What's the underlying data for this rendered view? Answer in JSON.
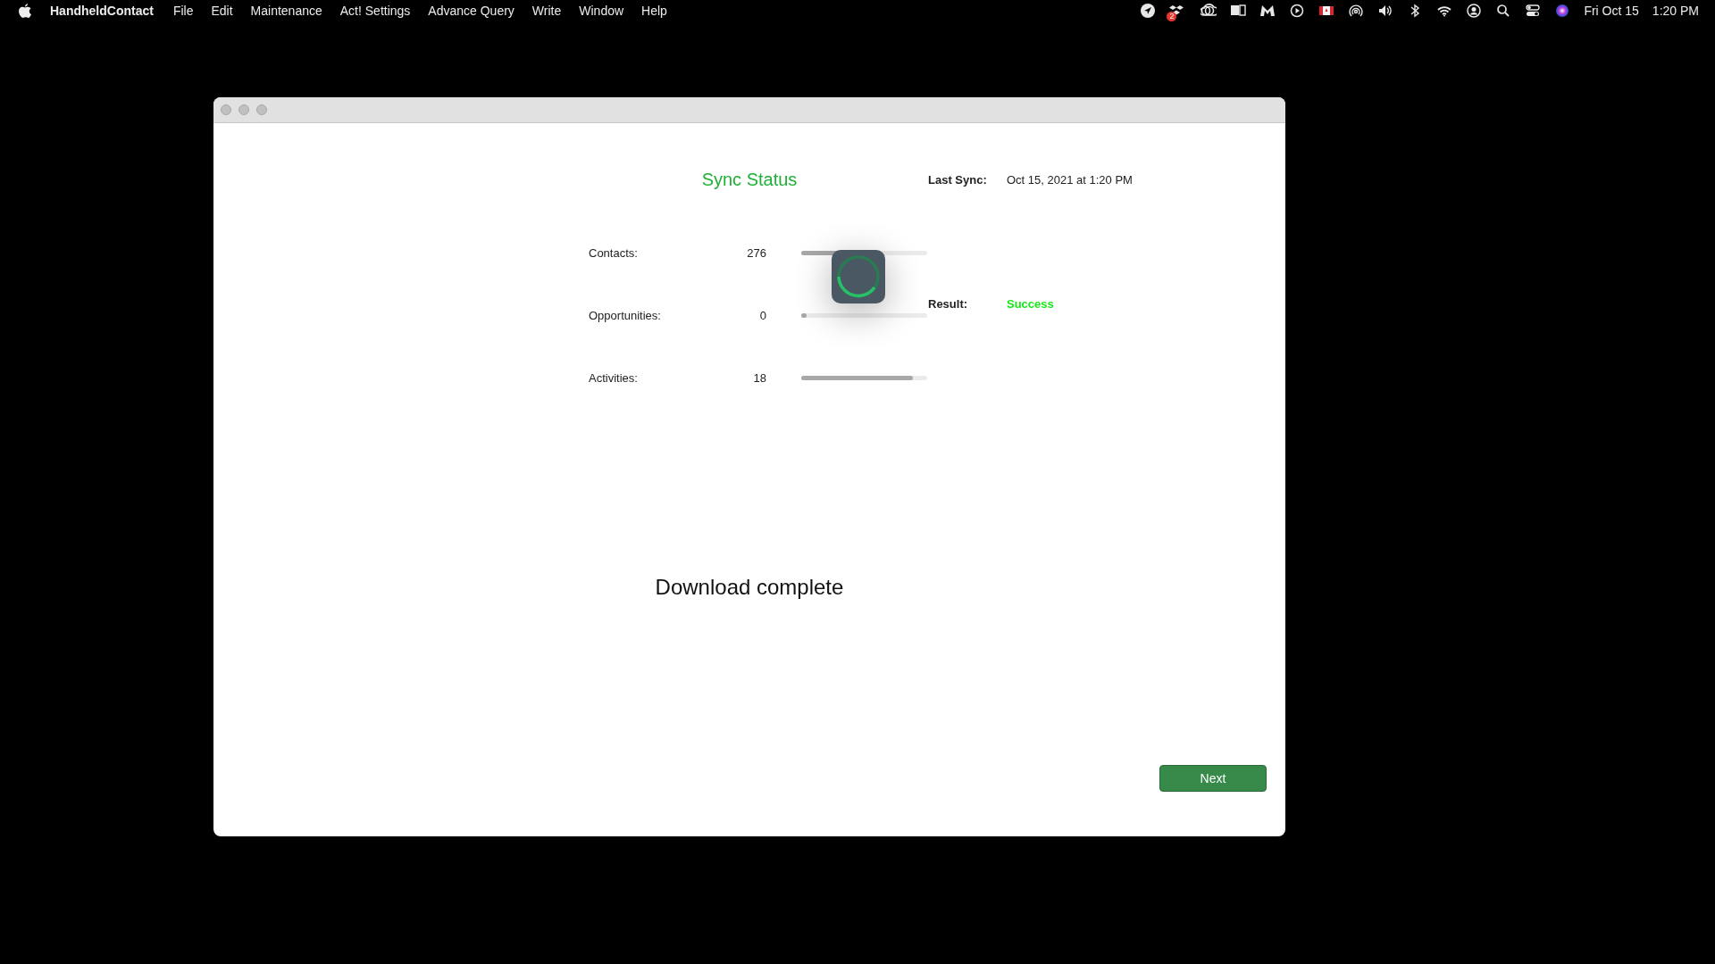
{
  "menu_bar": {
    "app_name": "HandheldContact",
    "menus": [
      "File",
      "Edit",
      "Maintenance",
      "Act! Settings",
      "Advance Query",
      "Write",
      "Window",
      "Help"
    ],
    "status_badge": "2",
    "date": "Fri Oct 15",
    "time": "1:20 PM"
  },
  "window": {
    "title": "Sync Status",
    "last_sync": {
      "label": "Last Sync:",
      "value": "Oct 15, 2021 at 1:20 PM"
    },
    "result": {
      "label": "Result:",
      "value": "Success"
    },
    "counts": [
      {
        "label": "Contacts:",
        "value": "276",
        "level": 0.39
      },
      {
        "label": "Opportunities:",
        "value": "0",
        "level": 0.04
      },
      {
        "label": "Activities:",
        "value": "18",
        "level": 0.89
      }
    ],
    "message": "Download complete",
    "buttons": [
      {
        "label": "Next"
      }
    ]
  }
}
